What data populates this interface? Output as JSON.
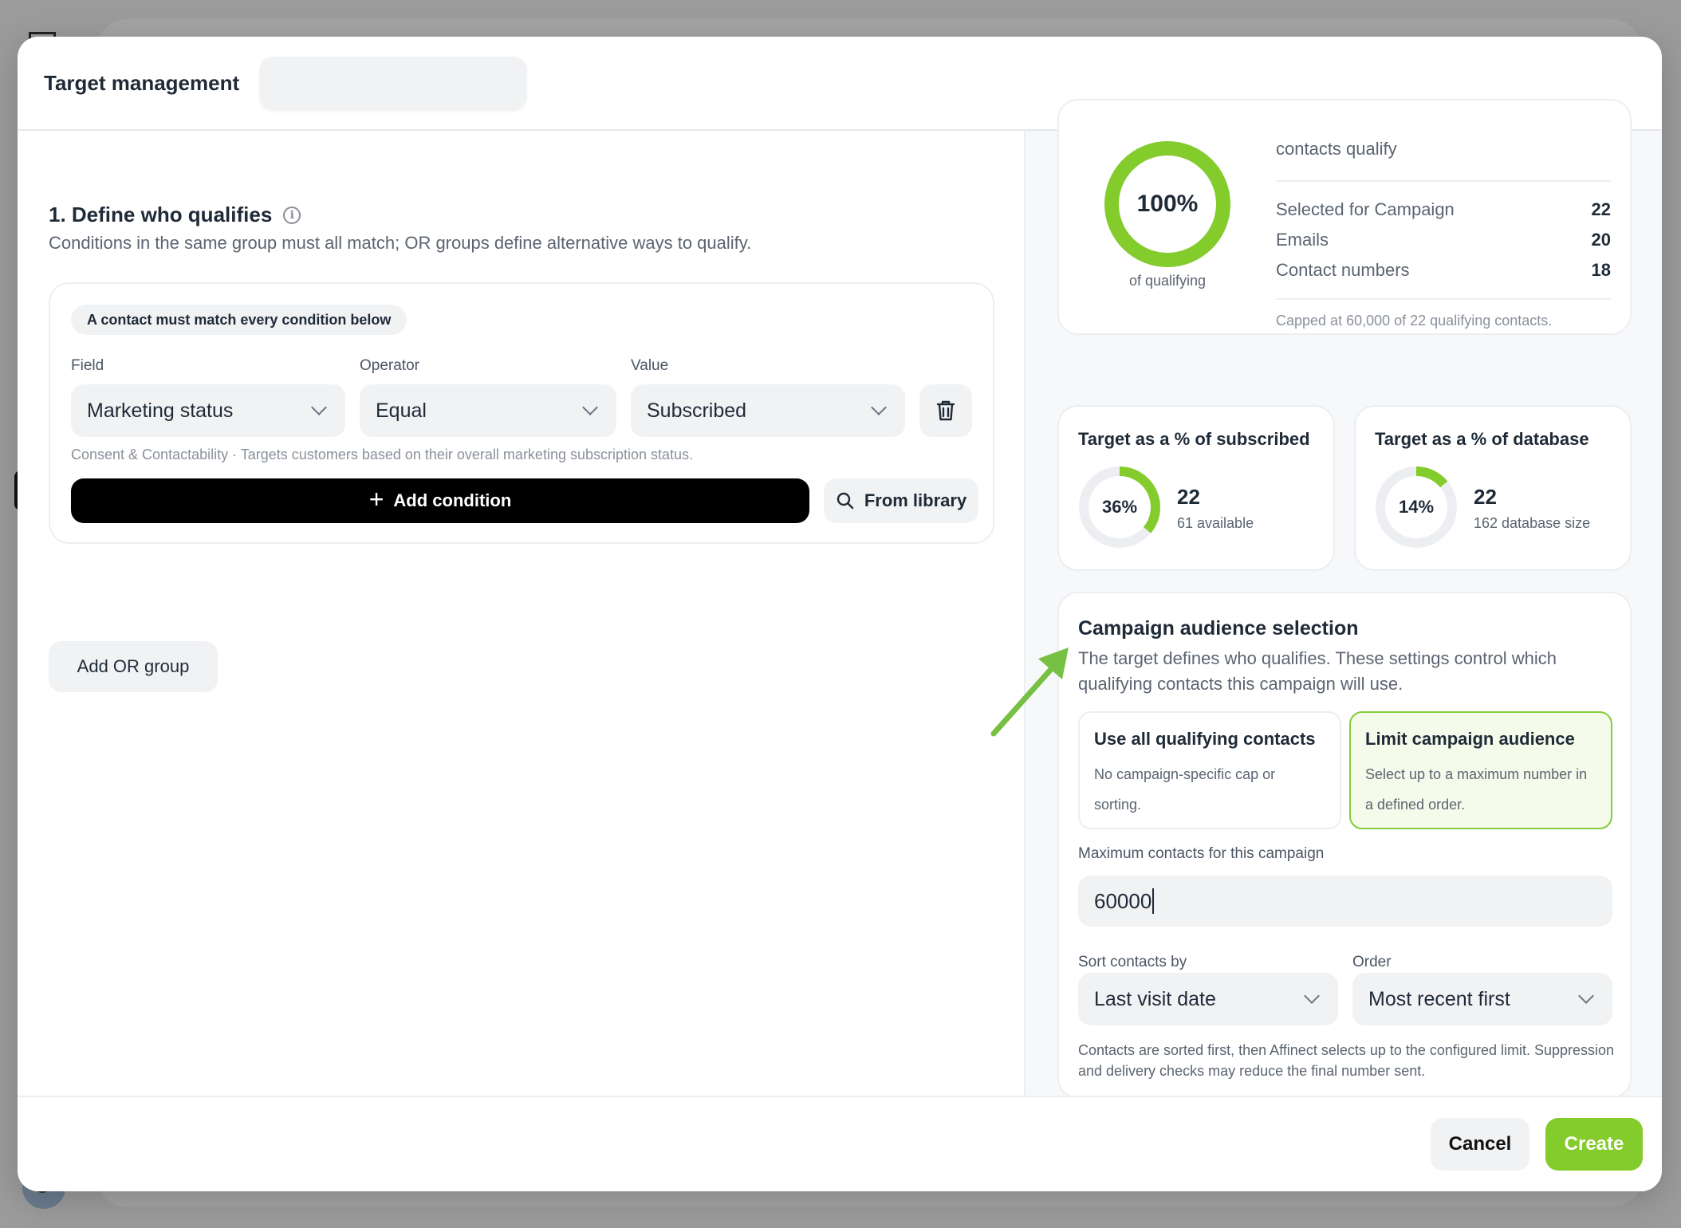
{
  "modal": {
    "title": "Target management",
    "title_input_value": ""
  },
  "define": {
    "title": "1. Define who qualifies",
    "description": "Conditions in the same group must all match; OR groups define alternative ways to qualify.",
    "group_badge": "A contact must match every condition below",
    "field_label": "Field",
    "operator_label": "Operator",
    "value_label": "Value",
    "field_value": "Marketing status",
    "operator_value": "Equal",
    "value_value": "Subscribed",
    "condition_hint": "Consent & Contactability · Targets customers based on their overall marketing subscription status.",
    "add_condition": "Add condition",
    "from_library": "From library",
    "add_or_group": "Add OR group"
  },
  "qualifying": {
    "percent": "100%",
    "percent_value": 1.0,
    "caption": "of qualifying",
    "headline": "contacts qualify",
    "rows": [
      {
        "label": "Selected for Campaign",
        "value": "22"
      },
      {
        "label": "Emails",
        "value": "20"
      },
      {
        "label": "Contact numbers",
        "value": "18"
      }
    ],
    "capped_note": "Capped at 60,000 of 22 qualifying contacts."
  },
  "subscribed_card": {
    "title": "Target as a % of subscribed",
    "percent": "36%",
    "percent_value": 0.36,
    "value": "22",
    "sub": "61 available"
  },
  "database_card": {
    "title": "Target as a % of database",
    "percent": "14%",
    "percent_value": 0.14,
    "value": "22",
    "sub": "162 database size"
  },
  "audience": {
    "title": "Campaign audience selection",
    "description": "The target defines who qualifies. These settings control which qualifying contacts this campaign will use.",
    "option_all_title": "Use all qualifying contacts",
    "option_all_desc": "No campaign-specific cap or sorting.",
    "option_limit_title": "Limit campaign audience",
    "option_limit_desc": "Select up to a maximum number in a defined order.",
    "max_label": "Maximum contacts for this campaign",
    "max_value": "60000",
    "sort_label": "Sort contacts by",
    "sort_value": "Last visit date",
    "order_label": "Order",
    "order_value": "Most recent first",
    "note": "Contacts are sorted first, then Affinect selects up to the configured limit. Suppression and delivery checks may reduce the final number sent."
  },
  "footer": {
    "cancel": "Cancel",
    "create": "Create"
  },
  "colors": {
    "accent_green": "#84cc2c",
    "ring_track": "#eceef1",
    "primary_black": "#000000",
    "arrow_green": "#76c043"
  },
  "icons": {
    "info": "info-icon",
    "chevron": "chevron-down-icon",
    "trash": "trash-icon",
    "plus": "plus-icon",
    "search": "search-icon",
    "arrow": "arrow-annotation-icon"
  }
}
